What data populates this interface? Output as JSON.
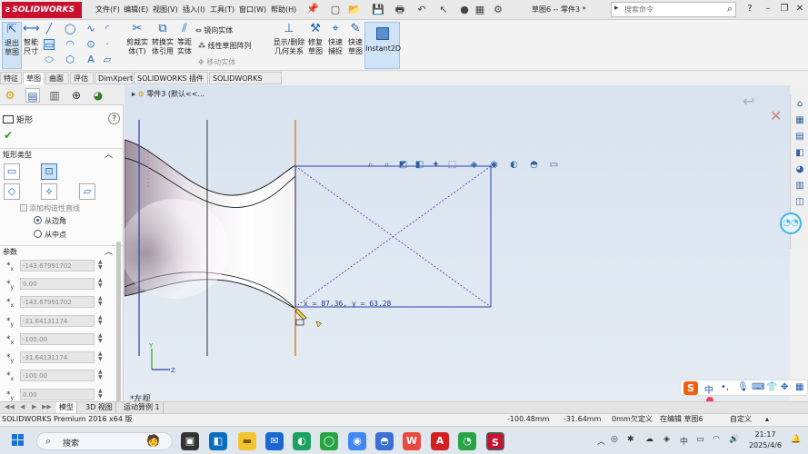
{
  "titlebar": {
    "logo": "SOLIDWORKS",
    "menu": [
      "文件(F)",
      "编辑(E)",
      "视图(V)",
      "插入(I)",
      "工具(T)",
      "窗口(W)",
      "帮助(H)"
    ],
    "doc_title": "草图6 -- 零件3 *",
    "search_placeholder": "搜索命令"
  },
  "ribbon": {
    "exit_sketch": "退出\n草图",
    "smart_dim": "智能\n尺寸",
    "trim": "剪裁实\n体(T)",
    "convert": "转换实\n体引用",
    "offset": "等距\n实体",
    "mirror": "镜向实体",
    "linear_pattern": "线性草图阵列",
    "move": "移动实体",
    "display_delete": "显示/删除\n几何关系",
    "repair": "修复\n草图",
    "quick_snap": "快速\n捕捉",
    "quick_sketch": "快速\n草图",
    "instant2d": "Instant2D"
  },
  "command_tabs": [
    "特征",
    "草图",
    "曲面",
    "评估",
    "DimXpert",
    "SOLIDWORKS 插件",
    "SOLIDWORKS MBD"
  ],
  "command_tabs_active": 1,
  "property_manager": {
    "title": "矩形",
    "rect_type_label": "矩形类型",
    "construction_line": "添加构造性直线",
    "from_corner": "从边角",
    "from_midpoint": "从中点",
    "params_label": "参数",
    "params": [
      "-143.67991702",
      "0.00",
      "-143.67991702",
      "-31.64131174",
      "-100.00",
      "-31.64131174",
      "-100.00",
      "0.00"
    ],
    "param_icons": [
      "x",
      "y",
      "x",
      "y",
      "x",
      "y",
      "x",
      "y"
    ]
  },
  "graphics": {
    "feature_tree": "零件3 (默认<<...",
    "coord_readout": "x = 87.36, y = 63.28",
    "view_label": "*左视"
  },
  "bottom_tabs": [
    "模型",
    "3D 视图",
    "运动算例 1"
  ],
  "statusbar": {
    "product": "SOLIDWORKS Premium 2016 x64 版",
    "x": "-100.48mm",
    "y": "-31.64mm",
    "z": "0mm",
    "state": "欠定义",
    "editing": "在编辑 草图6",
    "custom": "自定义"
  },
  "taskbar": {
    "search": "搜索",
    "time": "21:17",
    "date": "2025/4/6",
    "ime_mode": "中"
  },
  "colors": {
    "accent": "#1c62b5",
    "logo": "#c8102e",
    "sketch_line": "#2b3fb0",
    "centerline": "#e07b1a"
  }
}
